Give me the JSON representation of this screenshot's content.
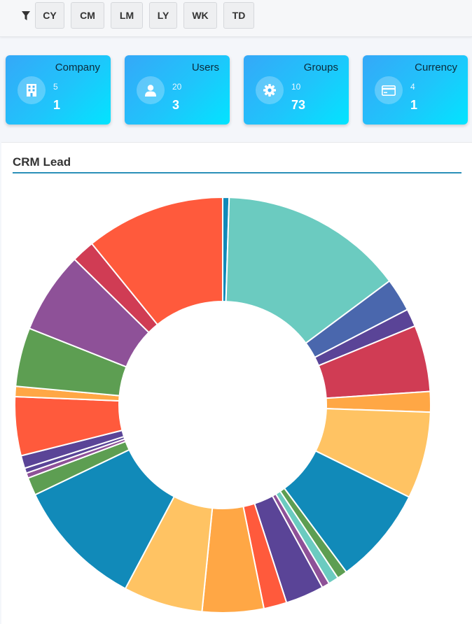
{
  "filters": {
    "buttons": [
      {
        "label": "CY",
        "active": true
      },
      {
        "label": "CM",
        "active": false
      },
      {
        "label": "LM",
        "active": false
      },
      {
        "label": "LY",
        "active": false
      },
      {
        "label": "WK",
        "active": false
      },
      {
        "label": "TD",
        "active": false
      }
    ]
  },
  "cards": [
    {
      "title": "Company",
      "small": "5",
      "big": "1",
      "icon": "building-icon"
    },
    {
      "title": "Users",
      "small": "20",
      "big": "3",
      "icon": "user-icon"
    },
    {
      "title": "Groups",
      "small": "10",
      "big": "73",
      "icon": "gear-icon"
    },
    {
      "title": "Currency",
      "small": "4",
      "big": "1",
      "icon": "credit-card-icon"
    }
  ],
  "panel": {
    "title": "CRM Lead"
  },
  "chart_data": {
    "type": "pie",
    "variant": "donut",
    "title": "CRM Lead",
    "legend": "none",
    "slices": [
      {
        "value": 0.5,
        "color": "#118ab9"
      },
      {
        "value": 14.4,
        "color": "#6bcbc0"
      },
      {
        "value": 2.6,
        "color": "#4a67ad"
      },
      {
        "value": 1.4,
        "color": "#5a4497"
      },
      {
        "value": 5.2,
        "color": "#d03c54"
      },
      {
        "value": 1.6,
        "color": "#ffa745"
      },
      {
        "value": 6.8,
        "color": "#ffc363"
      },
      {
        "value": 7.6,
        "color": "#118ab9"
      },
      {
        "value": 0.8,
        "color": "#5d9e52"
      },
      {
        "value": 0.8,
        "color": "#6bcbc0"
      },
      {
        "value": 0.6,
        "color": "#8e5198"
      },
      {
        "value": 3.0,
        "color": "#5a4497"
      },
      {
        "value": 1.8,
        "color": "#ff5a3c"
      },
      {
        "value": 4.8,
        "color": "#ffa745"
      },
      {
        "value": 6.2,
        "color": "#ffc363"
      },
      {
        "value": 10.2,
        "color": "#118ab9"
      },
      {
        "value": 1.4,
        "color": "#5d9e52"
      },
      {
        "value": 0.4,
        "color": "#8e5198"
      },
      {
        "value": 0.4,
        "color": "#5a4497"
      },
      {
        "value": 1.0,
        "color": "#5a4497"
      },
      {
        "value": 4.6,
        "color": "#ff5a3c"
      },
      {
        "value": 0.8,
        "color": "#ffa745"
      },
      {
        "value": 4.6,
        "color": "#5d9e52"
      },
      {
        "value": 6.4,
        "color": "#8e5198"
      },
      {
        "value": 1.8,
        "color": "#d03c54"
      },
      {
        "value": 10.9,
        "color": "#ff5a3c"
      }
    ]
  }
}
